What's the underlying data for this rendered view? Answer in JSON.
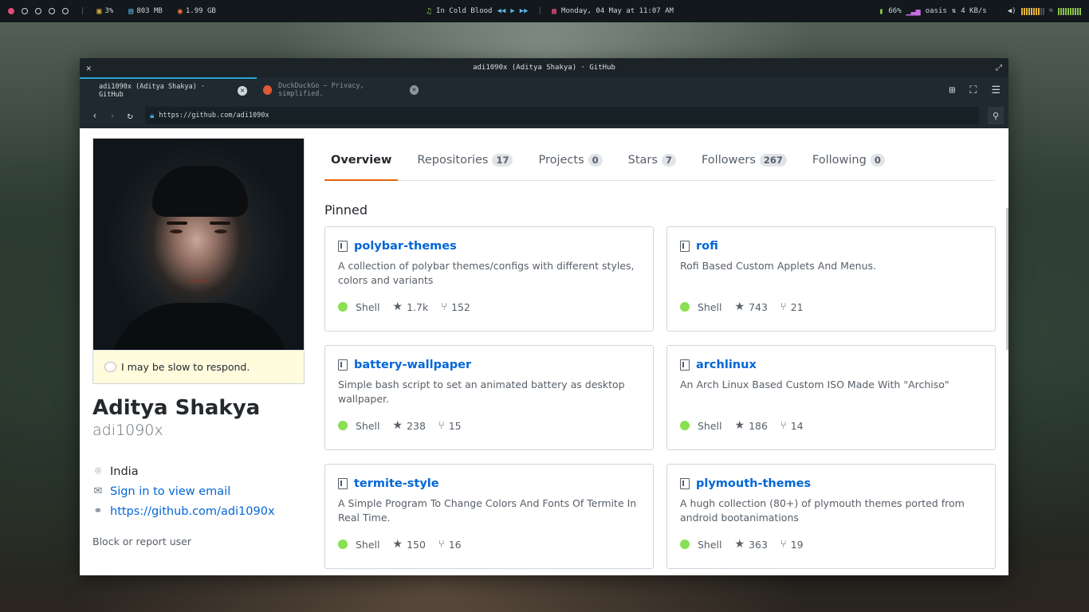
{
  "topbar": {
    "cpu": "3%",
    "memory": "803 MB",
    "disk": "1.99 GB",
    "song": "In Cold Blood",
    "datetime": "Monday, 04 May at 11:07 AM",
    "battery": "66%",
    "network_name": "oasis",
    "network_speed": "4 KB/s"
  },
  "window": {
    "title": "adi1090x (Aditya Shakya) · GitHub"
  },
  "tabs": [
    {
      "title": "adi1090x (Aditya Shakya) · GitHub"
    },
    {
      "title": "DuckDuckGo — Privacy, simplified."
    }
  ],
  "address_bar": {
    "url": "https://github.com/adi1090x"
  },
  "profile": {
    "status": "I may be slow to respond.",
    "full_name": "Aditya Shakya",
    "username": "adi1090x",
    "location": "India",
    "email_link": "Sign in to view email",
    "website": "https://github.com/adi1090x",
    "block_report": "Block or report user"
  },
  "nav_tabs": [
    {
      "label": "Overview",
      "count": null
    },
    {
      "label": "Repositories",
      "count": "17"
    },
    {
      "label": "Projects",
      "count": "0"
    },
    {
      "label": "Stars",
      "count": "7"
    },
    {
      "label": "Followers",
      "count": "267"
    },
    {
      "label": "Following",
      "count": "0"
    }
  ],
  "pinned": {
    "title": "Pinned",
    "repos": [
      {
        "name": "polybar-themes",
        "description": "A collection of polybar themes/configs with different styles, colors and variants",
        "language": "Shell",
        "stars": "1.7k",
        "forks": "152"
      },
      {
        "name": "rofi",
        "description": "Rofi Based Custom Applets And Menus.",
        "language": "Shell",
        "stars": "743",
        "forks": "21"
      },
      {
        "name": "battery-wallpaper",
        "description": "Simple bash script to set an animated battery as desktop wallpaper.",
        "language": "Shell",
        "stars": "238",
        "forks": "15"
      },
      {
        "name": "archlinux",
        "description": "An Arch Linux Based Custom ISO Made With \"Archiso\"",
        "language": "Shell",
        "stars": "186",
        "forks": "14"
      },
      {
        "name": "termite-style",
        "description": "A Simple Program To Change Colors And Fonts Of Termite In Real Time.",
        "language": "Shell",
        "stars": "150",
        "forks": "16"
      },
      {
        "name": "plymouth-themes",
        "description": "A hugh collection (80+) of plymouth themes ported from android bootanimations",
        "language": "Shell",
        "stars": "363",
        "forks": "19"
      }
    ]
  },
  "colors": {
    "shell_language": "#89e051",
    "link": "#0366d6",
    "selected_tab_underline": "#e36209",
    "workspace_active": "#e24c7a",
    "status_bg": "#fffbdd"
  }
}
